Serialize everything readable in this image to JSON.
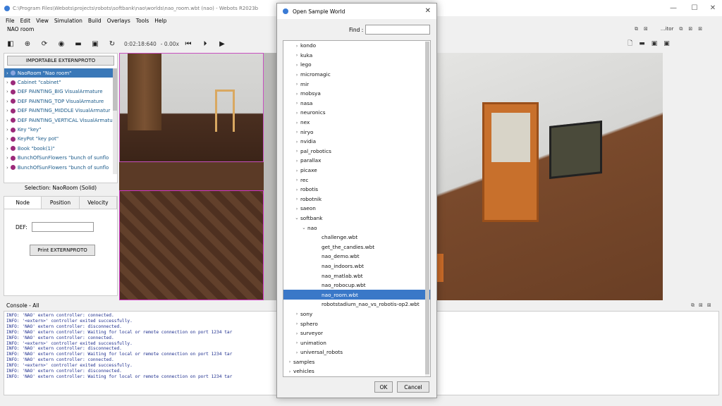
{
  "window": {
    "title": "C:\\Program Files\\Webots\\projects\\robots\\softbank\\nao\\worlds\\nao_room.wbt (nao) - Webots R2023b",
    "minimize": "—",
    "maximize": "☐",
    "close": "✕"
  },
  "menu": [
    "File",
    "Edit",
    "View",
    "Simulation",
    "Build",
    "Overlays",
    "Tools",
    "Help"
  ],
  "subtitle": "NAO room",
  "toolbar": {
    "time": "0:02:18:640",
    "speed": "- 0.00x",
    "editor_label": "...itor"
  },
  "scene_tree": {
    "importable_button": "IMPORTABLE EXTERNPROTO",
    "items": [
      "NaoRoom \"Nao room\"",
      "Cabinet \"cabinet\"",
      "DEF PAINTING_BIG VisualArmature",
      "DEF PAINTING_TOP VisualArmature",
      "DEF PAINTING_MIDDLE VisualArmatur",
      "DEF PAINTING_VERTICAL VisualArmatu",
      "Key \"key\"",
      "KeyPot \"key pot\"",
      "Book \"book(1)\"",
      "BunchOfSunFlowers \"bunch of sunflo",
      "BunchOfSunFlowers \"bunch of sunflo"
    ]
  },
  "selection_label": "Selection: NaoRoom (Solid)",
  "field_editor": {
    "tabs": [
      "Node",
      "Position",
      "Velocity"
    ],
    "def_label": "DEF:",
    "def_value": "",
    "print_button": "Print EXTERNPROTO"
  },
  "console": {
    "header": "Console - All",
    "lines": [
      "INFO: 'NAO' extern controller: connected.",
      "INFO: '<extern>' controller exited successfully.",
      "INFO: 'NAO' extern controller: disconnected.",
      "INFO: 'NAO' extern controller: Waiting for local or remote connection on port 1234 tar",
      "INFO: 'NAO' extern controller: connected.",
      "INFO: '<extern>' controller exited successfully.",
      "INFO: 'NAO' extern controller: disconnected.",
      "INFO: 'NAO' extern controller: Waiting for local or remote connection on port 1234 tar",
      "INFO: 'NAO' extern controller: connected.",
      "INFO: '<extern>' controller exited successfully.",
      "INFO: 'NAO' extern controller: disconnected.",
      "INFO: 'NAO' extern controller: Waiting for local or remote connection on port 1234 tar"
    ]
  },
  "dialog": {
    "title": "Open Sample World",
    "close": "✕",
    "find_label": "Find :",
    "find_value": "",
    "items": [
      {
        "label": "kondo",
        "level": 1,
        "chev": "›"
      },
      {
        "label": "kuka",
        "level": 1,
        "chev": "›"
      },
      {
        "label": "lego",
        "level": 1,
        "chev": "›"
      },
      {
        "label": "micromagic",
        "level": 1,
        "chev": "›"
      },
      {
        "label": "mir",
        "level": 1,
        "chev": "›"
      },
      {
        "label": "mobsya",
        "level": 1,
        "chev": "›"
      },
      {
        "label": "nasa",
        "level": 1,
        "chev": "›"
      },
      {
        "label": "neuronics",
        "level": 1,
        "chev": "›"
      },
      {
        "label": "nex",
        "level": 1,
        "chev": "›"
      },
      {
        "label": "niryo",
        "level": 1,
        "chev": "›"
      },
      {
        "label": "nvidia",
        "level": 1,
        "chev": "›"
      },
      {
        "label": "pal_robotics",
        "level": 1,
        "chev": "›"
      },
      {
        "label": "parallax",
        "level": 1,
        "chev": "›"
      },
      {
        "label": "picaxe",
        "level": 1,
        "chev": "›"
      },
      {
        "label": "rec",
        "level": 1,
        "chev": "›"
      },
      {
        "label": "robotis",
        "level": 1,
        "chev": "›"
      },
      {
        "label": "robotnik",
        "level": 1,
        "chev": "›"
      },
      {
        "label": "saeon",
        "level": 1,
        "chev": "›"
      },
      {
        "label": "softbank",
        "level": 1,
        "chev": "⌄"
      },
      {
        "label": "nao",
        "level": 2,
        "chev": "⌄"
      },
      {
        "label": "challenge.wbt",
        "level": 3,
        "chev": ""
      },
      {
        "label": "get_the_candies.wbt",
        "level": 3,
        "chev": ""
      },
      {
        "label": "nao_demo.wbt",
        "level": 3,
        "chev": ""
      },
      {
        "label": "nao_indoors.wbt",
        "level": 3,
        "chev": ""
      },
      {
        "label": "nao_matlab.wbt",
        "level": 3,
        "chev": ""
      },
      {
        "label": "nao_robocup.wbt",
        "level": 3,
        "chev": ""
      },
      {
        "label": "nao_room.wbt",
        "level": 3,
        "chev": "",
        "selected": true
      },
      {
        "label": "robotstadium_nao_vs_robotis-op2.wbt",
        "level": 3,
        "chev": ""
      },
      {
        "label": "sony",
        "level": 1,
        "chev": "›"
      },
      {
        "label": "sphero",
        "level": 1,
        "chev": "›"
      },
      {
        "label": "surveyor",
        "level": 1,
        "chev": "›"
      },
      {
        "label": "unimation",
        "level": 1,
        "chev": "›"
      },
      {
        "label": "universal_robots",
        "level": 1,
        "chev": "›"
      },
      {
        "label": "samples",
        "level": 0,
        "chev": "›"
      },
      {
        "label": "vehicles",
        "level": 0,
        "chev": "›"
      }
    ],
    "ok": "OK",
    "cancel": "Cancel"
  },
  "colors": {
    "selection": "#3a78c8",
    "tree_text": "#1a5a8a",
    "console_text": "#1e2e8e",
    "node_dot": "#9b2a7a"
  }
}
